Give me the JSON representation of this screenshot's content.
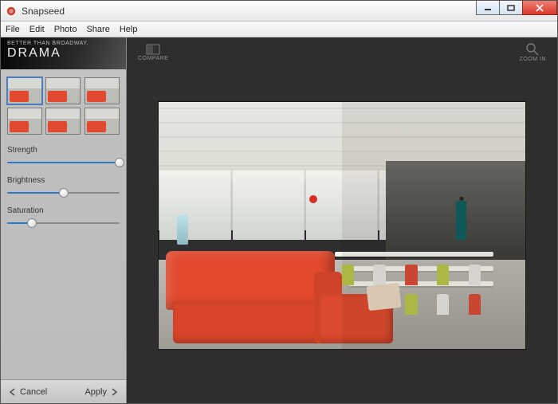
{
  "window": {
    "title": "Snapseed"
  },
  "menu": {
    "file": "File",
    "edit": "Edit",
    "photo": "Photo",
    "share": "Share",
    "help": "Help"
  },
  "sidebar": {
    "subtitle": "BETTER THAN BROADWAY.",
    "title": "DRAMA",
    "controls": {
      "strength": {
        "label": "Strength",
        "value": 100
      },
      "brightness": {
        "label": "Brightness",
        "value": 50
      },
      "saturation": {
        "label": "Saturation",
        "value": 22
      }
    },
    "footer": {
      "cancel": "Cancel",
      "apply": "Apply"
    }
  },
  "toolbar": {
    "compare": "COMPARE",
    "zoom": "ZOOM IN"
  },
  "chairColors": [
    "#d94a36",
    "#d94a36",
    "#b9c64a",
    "#e5e5e0",
    "#d94a36",
    "#b9c64a",
    "#e5e5e0",
    "#d94a36",
    "#b9c64a",
    "#e5e5e0"
  ]
}
